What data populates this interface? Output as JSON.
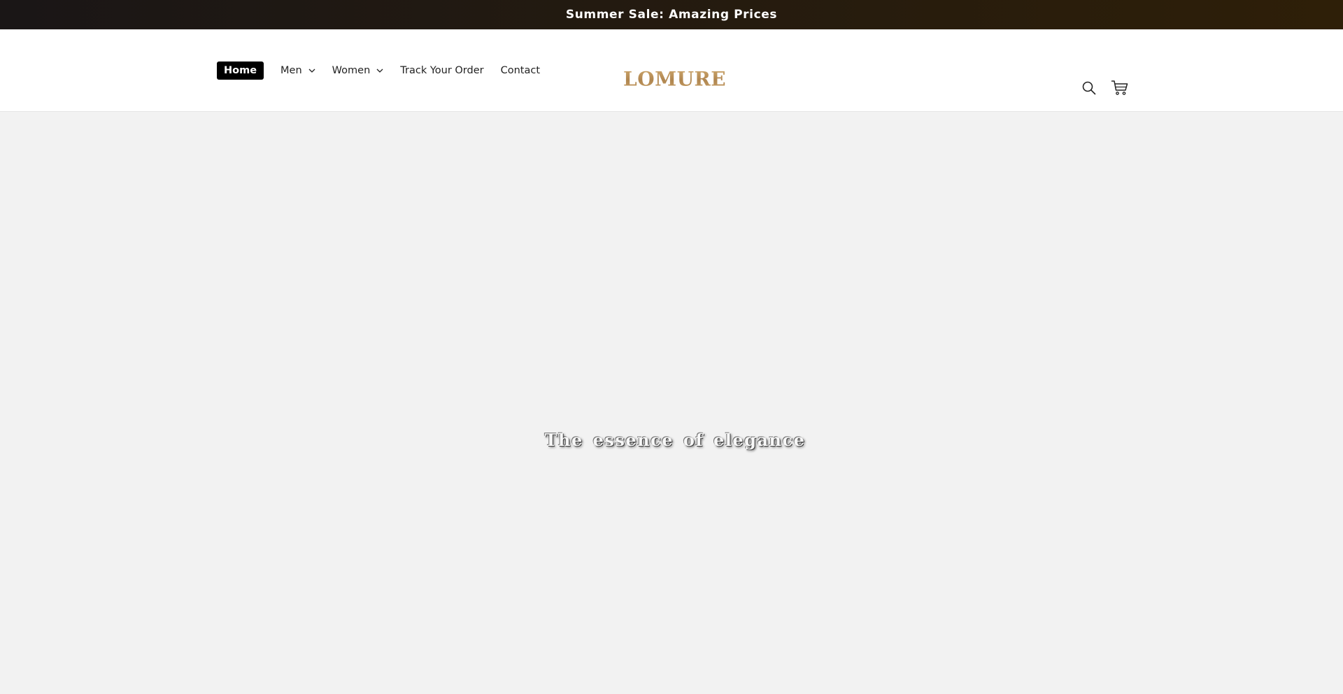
{
  "announcement": {
    "text": "Summer Sale: Amazing Prices"
  },
  "nav": {
    "items": [
      {
        "label": "Home",
        "active": true,
        "has_dropdown": false
      },
      {
        "label": "Men",
        "active": false,
        "has_dropdown": true
      },
      {
        "label": "Women",
        "active": false,
        "has_dropdown": true
      },
      {
        "label": "Track Your Order",
        "active": false,
        "has_dropdown": false
      },
      {
        "label": "Contact",
        "active": false,
        "has_dropdown": false
      }
    ]
  },
  "logo": {
    "text": "LOMURE"
  },
  "header_icons": {
    "search": "search-icon",
    "cart": "cart-icon"
  },
  "hero": {
    "title": "The essence of elegance"
  },
  "colors": {
    "announcement_bg": "#231a10",
    "logo_gold": "#b8925a",
    "hero_bg": "#f2f2f2",
    "active_nav_bg": "#000000"
  }
}
